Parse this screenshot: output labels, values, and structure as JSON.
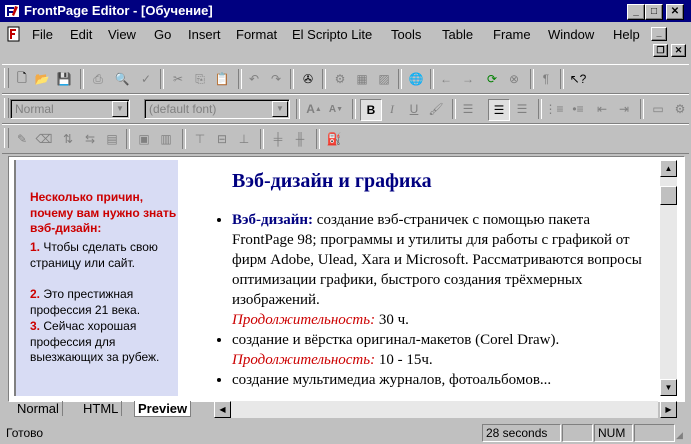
{
  "window": {
    "title": "FrontPage Editor - [Обучение]"
  },
  "menu": [
    "File",
    "Edit",
    "View",
    "Go",
    "Insert",
    "Format",
    "El Scripto Lite",
    "Tools",
    "Table",
    "Frame",
    "Window",
    "Help"
  ],
  "format_toolbar": {
    "style_value": "Normal",
    "font_value": "(default font)"
  },
  "sidebar": {
    "heading": "Несколько причин, почему вам нужно знать вэб-дизайн:",
    "reasons": [
      {
        "num": "1.",
        "text": "Чтобы сделать свою страницу или сайт."
      },
      {
        "num": "2.",
        "text": "Это престижная профессия 21 века."
      },
      {
        "num": "3.",
        "text": "Сейчас хорошая профессия для выезжающих за рубеж."
      }
    ]
  },
  "content": {
    "title": "Вэб-дизайн и графика",
    "item1_bold": "Вэб-дизайн:",
    "item1_text": "создание вэб-страничек с помощью пакета FrontPage 98; программы и утилиты для работы с графикой от фирм Adobe, Ulead, Xara и Microsoft. Рассматриваются вопросы оптимизации графики, быстрого создания трёхмерных изображений.",
    "duration_label": "Продолжительность:",
    "item1_duration": "30 ч.",
    "item2_text": "создание и вёрстка оригинал-макетов (Corel Draw).",
    "item2_duration": "10 - 15ч.",
    "item3_text": "создание мультимедиа журналов, фотоальбомов..."
  },
  "tabs": [
    "Normal",
    "HTML",
    "Preview"
  ],
  "active_tab": "Preview",
  "status": {
    "ready": "Готово",
    "time": "28 seconds",
    "num": "NUM"
  },
  "colors": {
    "titlebar": "#000080",
    "sidebar_bg": "#d8dcf4",
    "accent_red": "#cc0000",
    "heading_blue": "#000080"
  }
}
